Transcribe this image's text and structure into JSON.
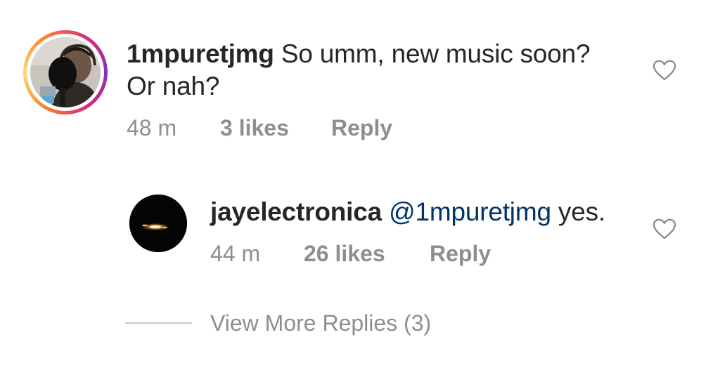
{
  "comments": [
    {
      "username": "1mpuretjmg",
      "text_line1": "So umm, new music soon?",
      "text_line2": "Or nah?",
      "time": "48 m",
      "likes": "3 likes",
      "reply_label": "Reply",
      "avatar_icon": "user-avatar-photo",
      "like_icon": "heart-outline-icon"
    }
  ],
  "replies": [
    {
      "username": "jayelectronica",
      "mention": "@1mpuretjmg",
      "text": "yes.",
      "time": "44 m",
      "likes": "26 likes",
      "reply_label": "Reply",
      "avatar_icon": "user-avatar-dark",
      "like_icon": "heart-outline-icon"
    }
  ],
  "view_more": {
    "label": "View More Replies (3)"
  },
  "colors": {
    "text": "#262626",
    "muted": "#8e8e8e",
    "mention": "#003569",
    "story_ring_start": "#f58529",
    "story_ring_end": "#dd2a7b"
  }
}
